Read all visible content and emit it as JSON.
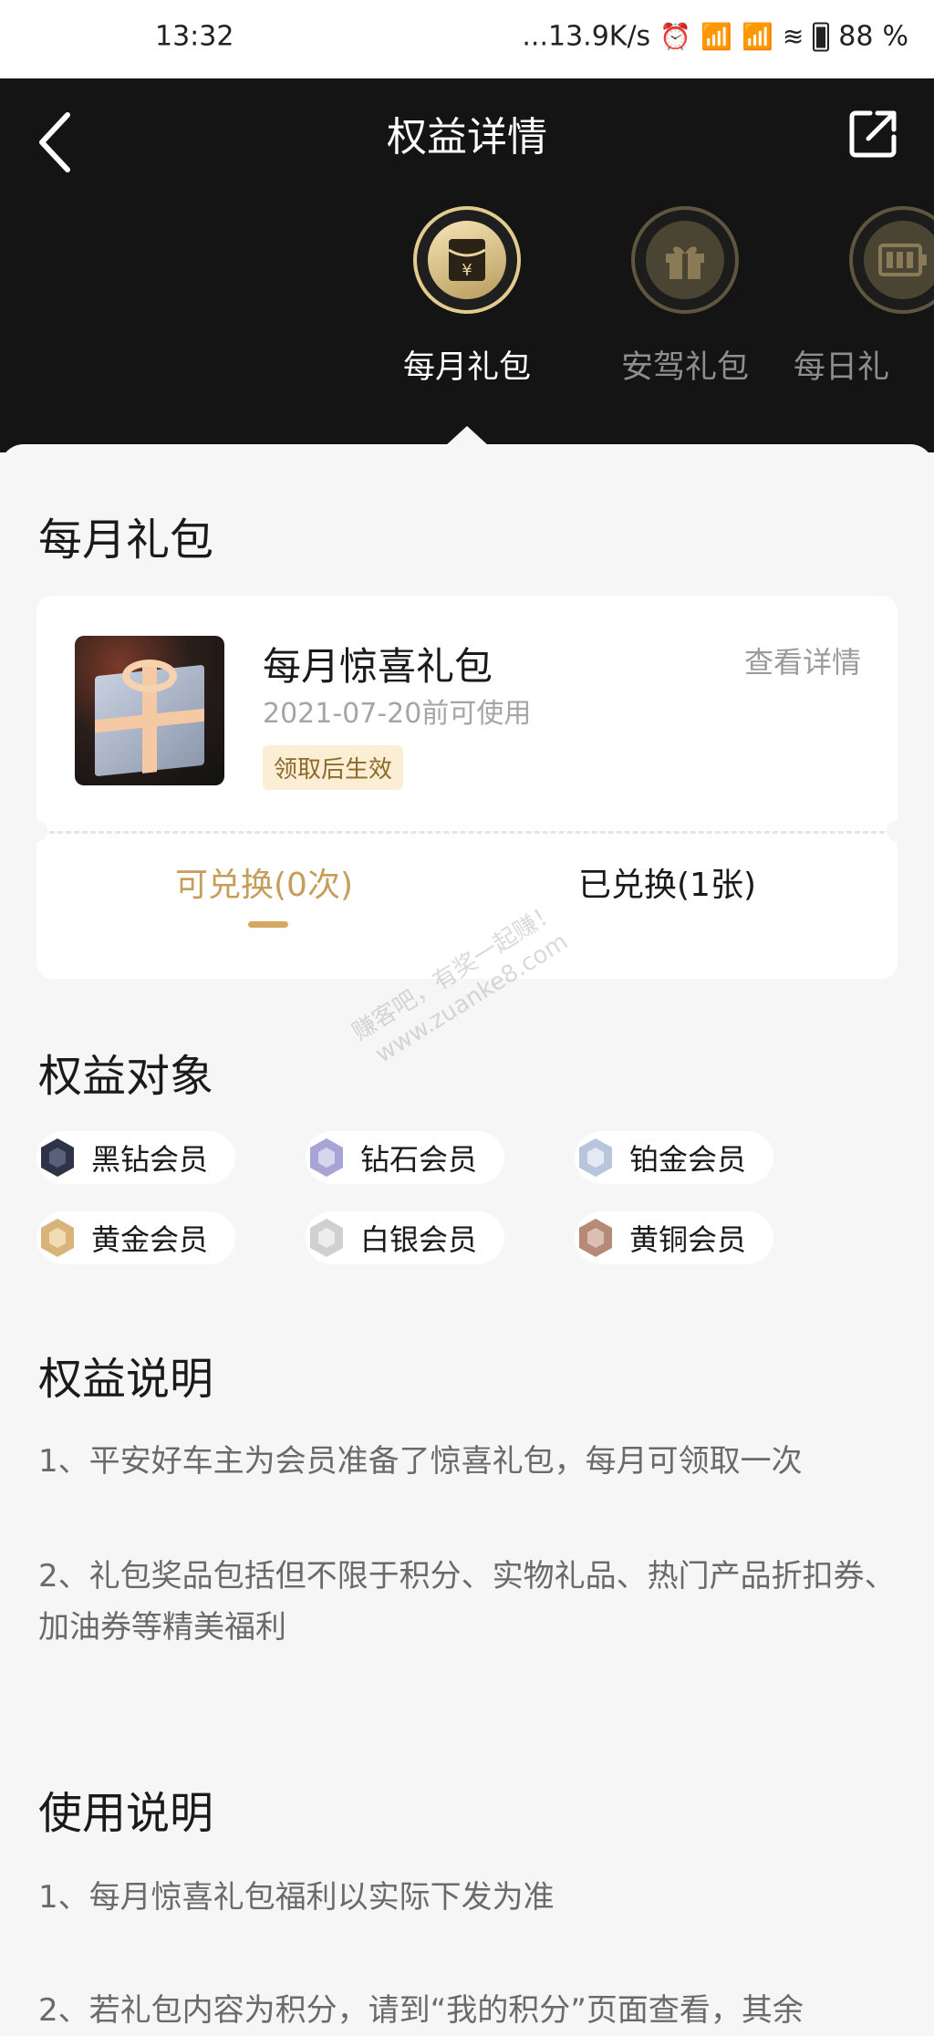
{
  "status_bar": {
    "time": "13:32",
    "network_speed": "...13.9K/s",
    "battery": "88",
    "battery_unit": "%"
  },
  "header": {
    "title": "权益详情",
    "back_icon": "chevron-left-icon",
    "share_icon": "share-icon"
  },
  "tabs": [
    {
      "label": "每月礼包",
      "icon": "red-envelope-yen-icon",
      "active": true
    },
    {
      "label": "安驾礼包",
      "icon": "gift-icon",
      "active": false
    },
    {
      "label": "每日礼",
      "icon": "battery-icon",
      "active": false
    }
  ],
  "sections": {
    "monthly_gift_title": "每月礼包",
    "benefit_target_title": "权益对象",
    "benefit_desc_title": "权益说明",
    "usage_title": "使用说明"
  },
  "gift_card": {
    "name": "每月惊喜礼包",
    "valid_until": "2021-07-20前可使用",
    "badge": "领取后生效",
    "detail_link": "查看详情",
    "tab_available": "可兑换(0次)",
    "tab_redeemed": "已兑换(1张)"
  },
  "members": [
    {
      "label": "黑钻会员",
      "icon": "black-diamond-medal-icon",
      "color": "#2e3348"
    },
    {
      "label": "钻石会员",
      "icon": "diamond-medal-icon",
      "color": "#a9a4d6"
    },
    {
      "label": "铂金会员",
      "icon": "platinum-medal-icon",
      "color": "#b8c6dc"
    },
    {
      "label": "黄金会员",
      "icon": "gold-medal-icon",
      "color": "#d9b47a"
    },
    {
      "label": "白银会员",
      "icon": "silver-medal-icon",
      "color": "#d0d0d0"
    },
    {
      "label": "黄铜会员",
      "icon": "bronze-medal-icon",
      "color": "#b58a78"
    }
  ],
  "benefit_desc": [
    "1、平安好车主为会员准备了惊喜礼包，每月可领取一次",
    "2、礼包奖品包括但不限于积分、实物礼品、热门产品折扣券、加油券等精美福利"
  ],
  "usage_desc": [
    "1、每月惊喜礼包福利以实际下发为准",
    "2、若礼包内容为积分，请到“我的积分”页面查看，其余"
  ],
  "watermark": [
    "赚客吧，有奖一起赚！",
    "www.zuanke8.com"
  ],
  "colors": {
    "header_bg": "#141414",
    "accent_gold": "#c59e5b",
    "page_bg": "#f6f6f6"
  }
}
